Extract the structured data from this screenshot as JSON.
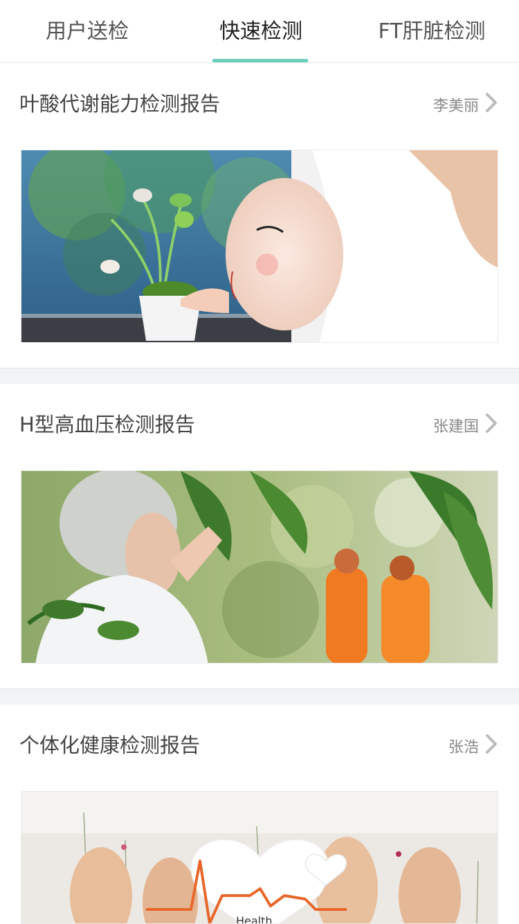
{
  "tabs": [
    {
      "label": "用户送检"
    },
    {
      "label": "快速检测",
      "active": true
    },
    {
      "label": "FT肝脏检测"
    }
  ],
  "accent_color": "#6fcfbe",
  "reports": [
    {
      "title": "叶酸代谢能力检测报告",
      "author": "李美丽",
      "image": "pregnant-belly-photo"
    },
    {
      "title": "H型高血压检测报告",
      "author": "张建国",
      "image": "elderly-woman-garden-photo"
    },
    {
      "title": "个体化健康检测报告",
      "author": "张浩",
      "image": "feet-heart-health-photo",
      "image_text": "Health"
    }
  ],
  "icons": {
    "chevron": "chevron-right-icon"
  }
}
